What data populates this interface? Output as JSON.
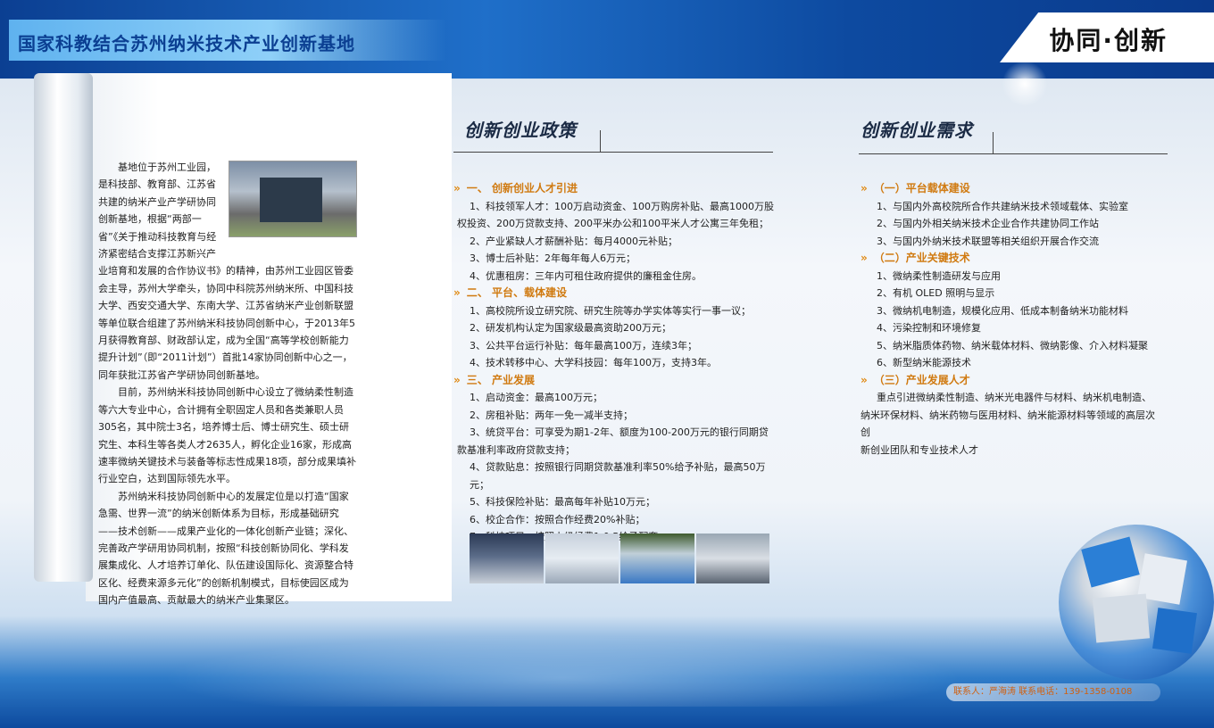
{
  "header": {
    "title": "国家科教结合苏州纳米技术产业创新基地",
    "slogan": "协同·创新"
  },
  "intro": {
    "paragraphs": [
      "基地位于苏州工业园，是科技部、教育部、江苏省共建的纳米产业产学研协同创新基地，根据“两部一省”《关于推动科技教育与经济紧密结合支撑江苏新兴产业培育和发展的合作协议书》的精神，由苏州工业园区管委会主导，苏州大学牵头，协同中科院苏州纳米所、中国科技大学、西安交通大学、东南大学、江苏省纳米产业创新联盟等单位联合组建了苏州纳米科技协同创新中心，于2013年5月获得教育部、财政部认定，成为全国“高等学校创新能力提升计划”（即“2011计划”）首批14家协同创新中心之一，同年获批江苏省产学研协同创新基地。",
      "目前，苏州纳米科技协同创新中心设立了微纳柔性制造等六大专业中心，合计拥有全职固定人员和各类兼职人员305名，其中院士3名，培养博士后、博士研究生、硕士研究生、本科生等各类人才2635人，孵化企业16家，形成高速率微纳关键技术与装备等标志性成果18项，部分成果填补行业空白，达到国际领先水平。",
      "苏州纳米科技协同创新中心的发展定位是以打造“国家急需、世界一流”的纳米创新体系为目标，形成基础研究——技术创新——成果产业化的一体化创新产业链；深化、完善政产学研用协同机制，按照“科技创新协同化、学科发展集成化、人才培养订单化、队伍建设国际化、资源整合特区化、经费来源多元化”的创新机制模式，目标使园区成为国内产值最高、贡献最大的纳米产业集聚区。"
    ]
  },
  "policy": {
    "title": "创新创业政策",
    "sections": [
      {
        "heading": "一、 创新创业人才引进",
        "items": [
          "1、科技领军人才：100万启动资金、100万购房补贴、最高1000万股",
          "权投资、200万贷款支持、200平米办公和100平米人才公寓三年免租；",
          "2、产业紧缺人才薪酬补贴：每月4000元补贴；",
          "3、博士后补贴：2年每年每人6万元；",
          "4、优惠租房：三年内可租住政府提供的廉租金住房。"
        ]
      },
      {
        "heading": "二、 平台、载体建设",
        "items": [
          "1、高校院所设立研究院、研究生院等办学实体等实行一事一议；",
          "2、研发机构认定为国家级最高资助200万元；",
          "3、公共平台运行补贴：每年最高100万，连续3年；",
          "4、技术转移中心、大学科技园：每年100万，支持3年。"
        ]
      },
      {
        "heading": "三、 产业发展",
        "items": [
          "1、启动资金：最高100万元；",
          "2、房租补贴：两年一免一减半支持；",
          "3、统贷平台：可享受为期1-2年、额度为100-200万元的银行同期贷",
          "款基准利率政府贷款支持；",
          "4、贷款贴息：按照银行同期贷款基准利率50%给予补贴，最高50万元；",
          "5、科技保险补贴：最高每年补贴10万元；",
          "6、校企合作：按照合作经费20%补贴；",
          "7、科技项目：按照上级经费1:0.5给予配套。"
        ]
      }
    ]
  },
  "demand": {
    "title": "创新创业需求",
    "sections": [
      {
        "heading": "（一）平台载体建设",
        "items": [
          "1、与国内外高校院所合作共建纳米技术领域载体、实验室",
          "2、与国内外相关纳米技术企业合作共建协同工作站",
          "3、与国内外纳米技术联盟等相关组织开展合作交流"
        ]
      },
      {
        "heading": "（二）产业关键技术",
        "items": [
          "1、微纳柔性制造研发与应用",
          "2、有机 OLED 照明与显示",
          "3、微纳机电制造，规模化应用、低成本制备纳米功能材料",
          "4、污染控制和环境修复",
          "5、纳米脂质体药物、纳米载体材料、微纳影像、介入材料凝聚",
          "6、新型纳米能源技术"
        ]
      },
      {
        "heading": "（三）产业发展人才",
        "items": [
          "重点引进微纳柔性制造、纳米光电器件与材料、纳米机电制造、",
          "纳米环保材料、纳米药物与医用材料、纳米能源材料等领域的高层次创",
          "新创业团队和专业技术人才"
        ]
      }
    ]
  },
  "contact": "联系人：严海涛 联系电话：139-1358-0108",
  "icons": {
    "section_arrow": "»"
  }
}
